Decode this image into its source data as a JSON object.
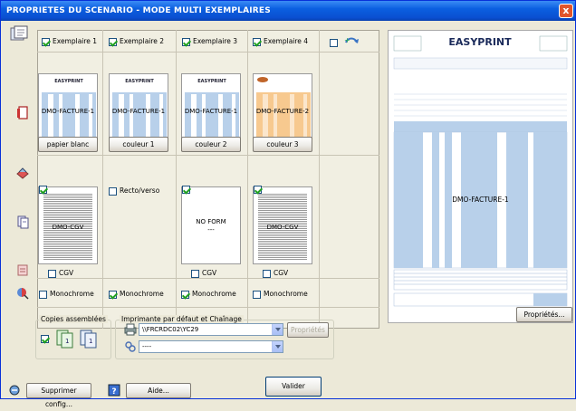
{
  "window": {
    "title": "PROPRIETES DU SCENARIO - MODE MULTI EXEMPLAIRES",
    "close_label": "x"
  },
  "columns": [
    {
      "checkbox_label": "Exemplaire 1",
      "checked": true,
      "thumb_label": "DMO-FACTURE-1",
      "paper_button": "papier blanc"
    },
    {
      "checkbox_label": "Exemplaire 2",
      "checked": true,
      "thumb_label": "DMO-FACTURE-1",
      "paper_button": "couleur 1"
    },
    {
      "checkbox_label": "Exemplaire 3",
      "checked": true,
      "thumb_label": "DMO-FACTURE-1",
      "paper_button": "couleur 2"
    },
    {
      "checkbox_label": "Exemplaire 4",
      "checked": true,
      "thumb_label": "DMO-FACTURE-2",
      "paper_button": "couleur 3"
    }
  ],
  "cgv_row": {
    "col1_label": "DMO-CGV",
    "recto_verso": "Recto/verso",
    "noform_label": "NO FORM",
    "noform_sub": "---",
    "col4_label": "DMO-CGV"
  },
  "cgv_checks": {
    "col1": "CGV",
    "col3": "CGV",
    "col4": "CGV"
  },
  "mono": {
    "col1": "Monochrome",
    "col2": "Monochrome",
    "col3": "Monochrome",
    "col4": "Monochrome"
  },
  "copies_group": {
    "title": "Copies assemblées"
  },
  "printer_group": {
    "title": "Imprimante par défaut et Chaînage",
    "printer_value": "\\\\FRCRDC02\\YC29",
    "props_button": "Propriétés",
    "chain_value": "----"
  },
  "preview": {
    "doc_label": "DMO-FACTURE-1",
    "brand": "EASY PRINT",
    "props_button": "Propriétés..."
  },
  "footer": {
    "delete_button": "Supprimer config...",
    "help_button": "Aide...",
    "validate_button": "Valider"
  },
  "colors": {
    "title_bar": "#0a4fd0",
    "accent_blue": "#1f56c7",
    "orange_form": "#f7c98f"
  }
}
